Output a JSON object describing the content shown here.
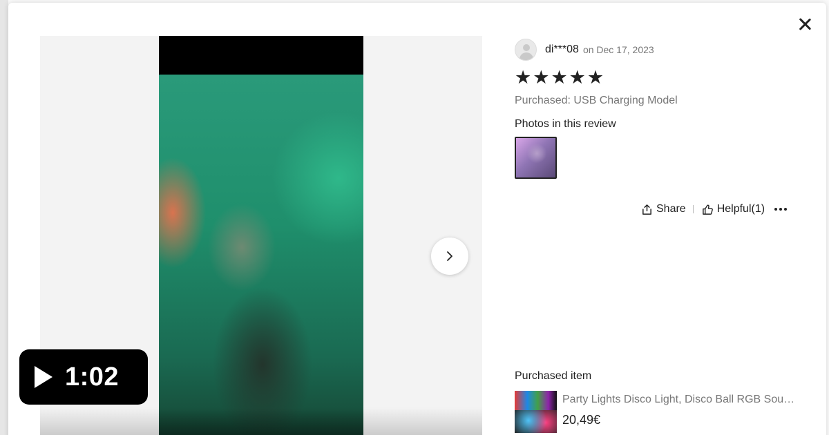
{
  "review": {
    "reviewer_name": "di***08",
    "date_text": "on Dec 17, 2023",
    "rating": 5,
    "star_glyph": "★",
    "purchased_variant": "Purchased: USB Charging Model",
    "photos_heading": "Photos in this review"
  },
  "actions": {
    "share_label": "Share",
    "helpful_label": "Helpful(1)"
  },
  "media": {
    "duration": "1:02"
  },
  "purchased_item": {
    "heading": "Purchased item",
    "title": "Party Lights Disco Light, Disco Ball RGB Sound Activated Strobe Light",
    "price": "20,49€"
  },
  "icons": {
    "close": "close-icon",
    "next": "chevron-right-icon",
    "play": "play-icon",
    "share": "share-icon",
    "helpful": "thumbs-up-icon",
    "more": "more-icon"
  }
}
